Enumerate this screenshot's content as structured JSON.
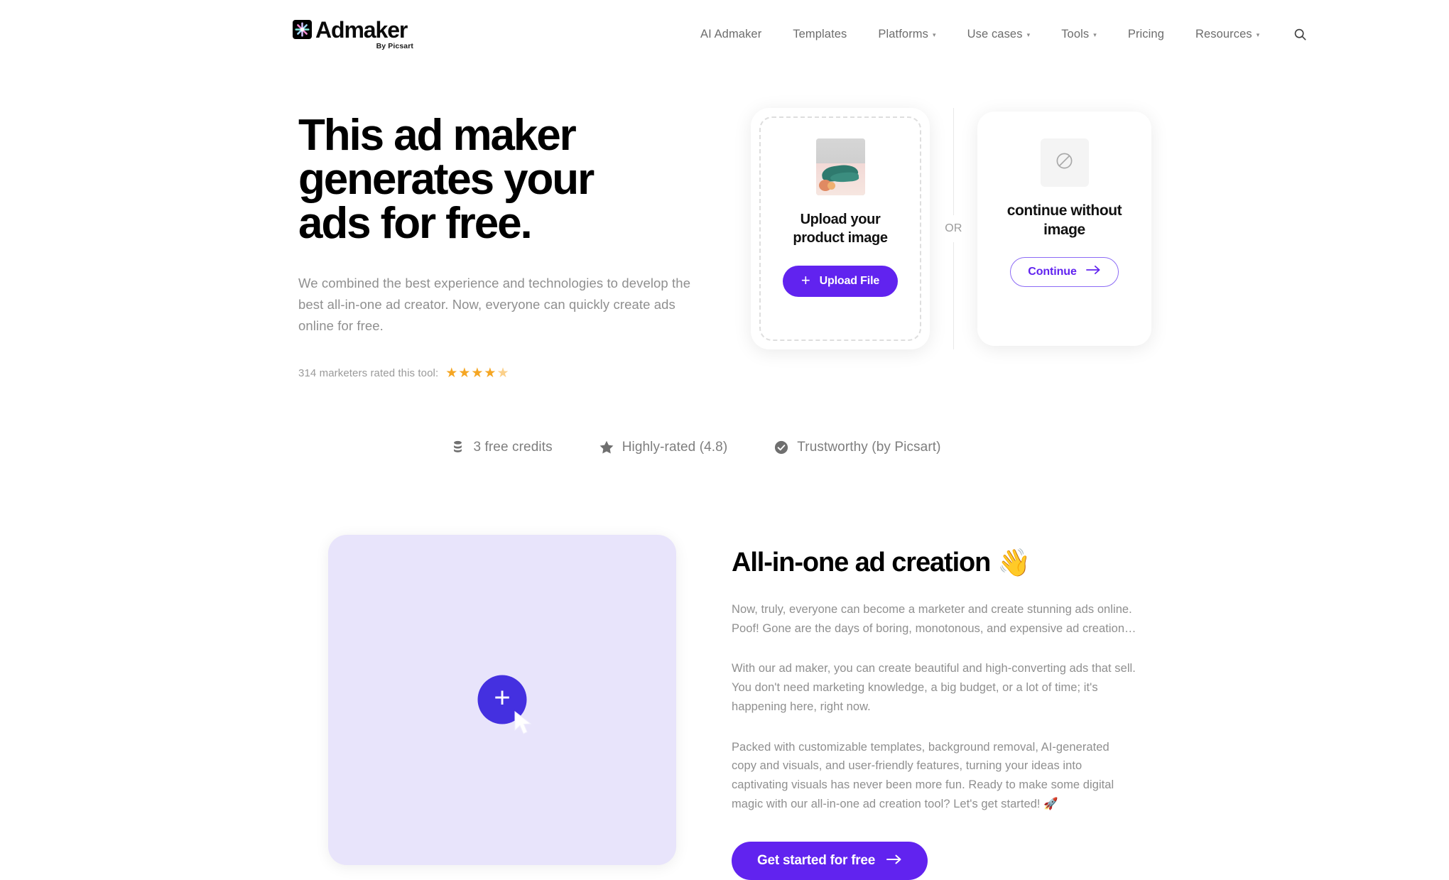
{
  "header": {
    "logo": {
      "word": "Admaker",
      "sub": "By Picsart",
      "icon": "admaker-star-logo-icon"
    },
    "nav": [
      {
        "label": "AI Admaker",
        "has_caret": false
      },
      {
        "label": "Templates",
        "has_caret": false
      },
      {
        "label": "Platforms",
        "has_caret": true
      },
      {
        "label": "Use cases",
        "has_caret": true
      },
      {
        "label": "Tools",
        "has_caret": true
      },
      {
        "label": "Pricing",
        "has_caret": false
      },
      {
        "label": "Resources",
        "has_caret": true
      }
    ],
    "search_icon": "search-icon"
  },
  "hero": {
    "title_lines": [
      "This ad maker",
      "generates your",
      "ads for free."
    ],
    "description": "We combined the best experience and technologies to develop the best all-in-one ad creator. Now, everyone can quickly create ads online for free.",
    "rating_text": "314 marketers rated this tool:",
    "stars_filled": 4,
    "stars_total": 5,
    "upload_card": {
      "title": "Upload your product image",
      "button_label": "Upload File",
      "thumbnail_alt": "green shoe product photo"
    },
    "divider_label": "OR",
    "no_image_card": {
      "icon": "no-image-icon",
      "title": "continue without image",
      "button_label": "Continue"
    }
  },
  "badges": [
    {
      "icon": "credits-icon",
      "label": "3 free credits"
    },
    {
      "icon": "star-icon",
      "label": "Highly-rated (4.8)"
    },
    {
      "icon": "check-badge-icon",
      "label": "Trustworthy (by Picsart)"
    }
  ],
  "feature": {
    "video_panel": {
      "play_icon": "plus-play-icon"
    },
    "title": "All-in-one ad creation",
    "title_emoji": "👋",
    "paragraphs": [
      "Now, truly, everyone can become a marketer and create stunning ads online. Poof! Gone are the days of boring, monotonous, and expensive ad creation…",
      "With our ad maker, you can create beautiful and high-converting ads that sell. You don't need marketing knowledge, a big budget, or a lot of time; it's happening here, right now.",
      "Packed with customizable templates, background removal, AI-generated copy and visuals, and user-friendly features, turning your ideas into captivating visuals has never been more fun. Ready to make some digital magic with our all-in-one ad creation tool? Let's get started! 🚀"
    ],
    "cta_label": "Get started for free"
  },
  "colors": {
    "brand_purple": "#6123ef",
    "play_purple": "#4430e0",
    "panel_lavender": "#e8e4fb",
    "star_gold": "#f5a623",
    "muted_text": "#8f8f8f"
  }
}
